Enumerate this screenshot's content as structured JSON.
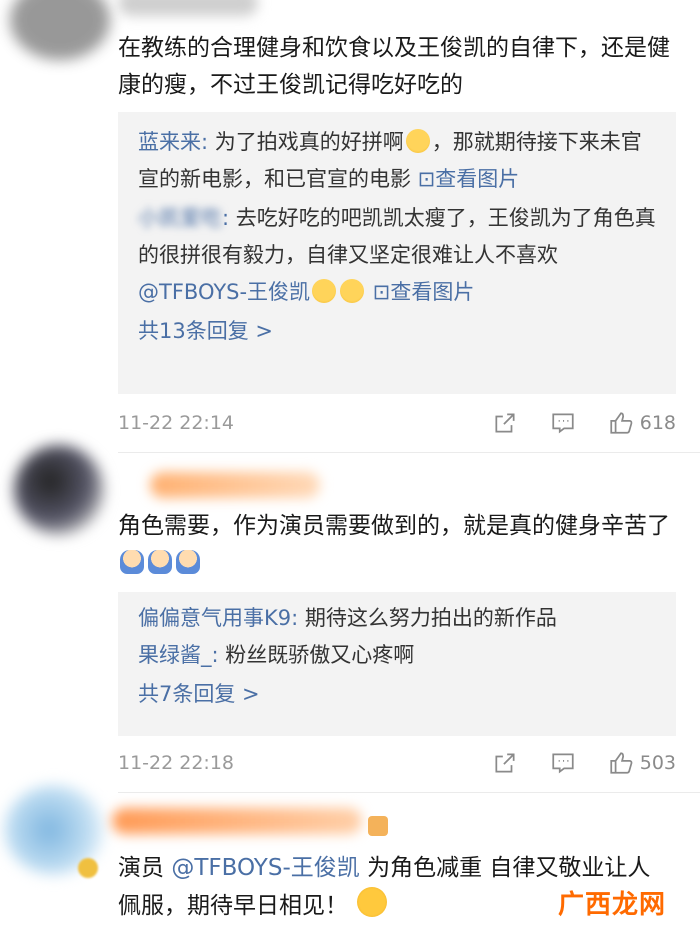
{
  "comments": [
    {
      "text": "在教练的合理健身和饮食以及王俊凯的自律下，还是健康的瘦，不过王俊凯记得吃好吃的",
      "replies": [
        {
          "user": "蓝来来",
          "text": "为了拍戏真的好拼啊",
          "emoji": "crying-face",
          "text2": "，那就期待接下来未官宣的新电影，和已官宣的电影 ",
          "link": "查看图片"
        },
        {
          "user": "",
          "text": "去吃好吃的吧凯凯太瘦了，王俊凯为了角色真的很拼很有毅力，自律又坚定很难让人不喜欢 ",
          "mention": "@TFBOYS-王俊凯",
          "link": "查看图片"
        }
      ],
      "more": "共13条回复 >",
      "time": "11-22 22:14",
      "likes": "618"
    },
    {
      "text": "角色需要，作为演员需要做到的，就是真的健身辛苦了",
      "replies": [
        {
          "user": "偏偏意气用事K9",
          "text": "期待这么努力拍出的新作品"
        },
        {
          "user": "果绿酱_",
          "text": "粉丝既骄傲又心疼啊"
        }
      ],
      "more": "共7条回复 >",
      "time": "11-22 22:18",
      "likes": "503"
    },
    {
      "text_prefix": "演员 ",
      "mention": "@TFBOYS-王俊凯",
      "text": " 为角色减重 自律又敬业让人佩服，期待早日相见！"
    }
  ],
  "watermark": "广西龙网",
  "colors": {
    "link": "#4a6fa5",
    "reply_bg": "#f3f3f3",
    "watermark": "#ff6a00"
  }
}
